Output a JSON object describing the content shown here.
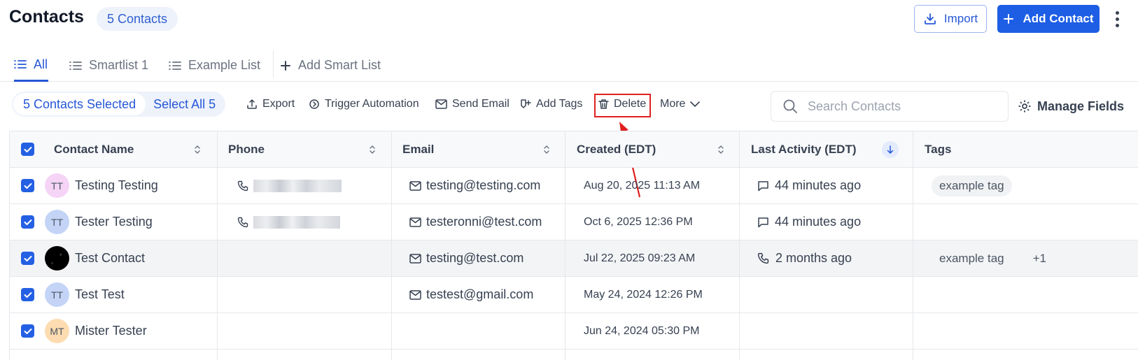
{
  "header": {
    "title": "Contacts",
    "count_badge": "5 Contacts",
    "import_label": "Import",
    "add_contact_label": "Add Contact"
  },
  "tabs": [
    {
      "label": "All",
      "icon": "list-icon",
      "active": true
    },
    {
      "label": "Smartlist 1",
      "icon": "list-icon",
      "active": false
    },
    {
      "label": "Example List",
      "icon": "list-icon",
      "active": false
    },
    {
      "label": "Add Smart List",
      "icon": "plus-icon",
      "active": false
    }
  ],
  "toolbar": {
    "selected_label": "5 Contacts Selected",
    "select_all_label": "Select All 5",
    "export_label": "Export",
    "trigger_label": "Trigger Automation",
    "send_email_label": "Send Email",
    "add_tags_label": "Add Tags",
    "delete_label": "Delete",
    "more_label": "More",
    "search_placeholder": "Search Contacts",
    "manage_fields_label": "Manage Fields"
  },
  "table": {
    "columns": [
      "Contact Name",
      "Phone",
      "Email",
      "Created (EDT)",
      "Last Activity (EDT)",
      "Tags"
    ],
    "rows": [
      {
        "initials": "TT",
        "avatar_color": "#f5d4f7",
        "name": "Testing Testing",
        "has_phone": true,
        "email": "testing@testing.com",
        "created": "Aug 20, 2025 11:13 AM",
        "activity_icon": "message-icon",
        "activity": "44 minutes ago",
        "tag": "example tag",
        "extra_tags": ""
      },
      {
        "initials": "TT",
        "avatar_color": "#c3d4f7",
        "name": "Tester Testing",
        "has_phone": true,
        "email": "testeronni@test.com",
        "created": "Oct 6, 2025 12:36 PM",
        "activity_icon": "message-icon",
        "activity": "44 minutes ago",
        "tag": "",
        "extra_tags": ""
      },
      {
        "initials": "",
        "avatar_color": "#000000",
        "name": "Test Contact",
        "has_phone": false,
        "email": "testing@test.com",
        "created": "Jul 22, 2025 09:23 AM",
        "activity_icon": "phone-icon",
        "activity": "2 months ago",
        "tag": "example tag",
        "extra_tags": "+1"
      },
      {
        "initials": "TT",
        "avatar_color": "#c3d4f7",
        "name": "Test Test",
        "has_phone": false,
        "email": "testest@gmail.com",
        "created": "May 24, 2024 12:26 PM",
        "activity_icon": "",
        "activity": "",
        "tag": "",
        "extra_tags": ""
      },
      {
        "initials": "MT",
        "avatar_color": "#fcdcb0",
        "name": "Mister Tester",
        "has_phone": false,
        "email": "",
        "created": "Jun 24, 2024 05:30 PM",
        "activity_icon": "",
        "activity": "",
        "tag": "",
        "extra_tags": ""
      }
    ]
  },
  "colors": {
    "accent": "#1d5ee5",
    "highlight": "#e02020",
    "hover_row": "#f3f4f6"
  }
}
